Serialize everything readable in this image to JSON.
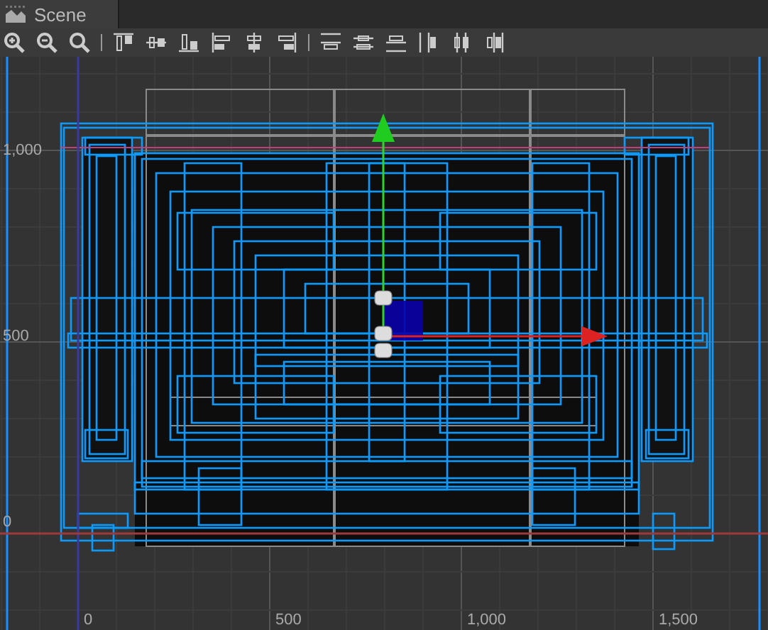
{
  "tabs": [
    {
      "label": "Scene",
      "selected": true
    }
  ],
  "toolbar": [
    {
      "kind": "zoom-in"
    },
    {
      "kind": "zoom-out"
    },
    {
      "kind": "zoom-reset"
    },
    {
      "kind": "separator"
    },
    {
      "kind": "align-top"
    },
    {
      "kind": "align-middle"
    },
    {
      "kind": "align-bottom"
    },
    {
      "kind": "align-left"
    },
    {
      "kind": "align-center"
    },
    {
      "kind": "align-right"
    },
    {
      "kind": "separator"
    },
    {
      "kind": "distribute-top"
    },
    {
      "kind": "distribute-middle"
    },
    {
      "kind": "distribute-bottom"
    },
    {
      "kind": "distribute-left"
    },
    {
      "kind": "distribute-center"
    },
    {
      "kind": "distribute-right"
    }
  ],
  "scene": {
    "y_axis_labels": [
      "1,000",
      "500",
      "0"
    ],
    "x_axis_labels": [
      "0",
      "500",
      "1,000",
      "1,500"
    ]
  }
}
